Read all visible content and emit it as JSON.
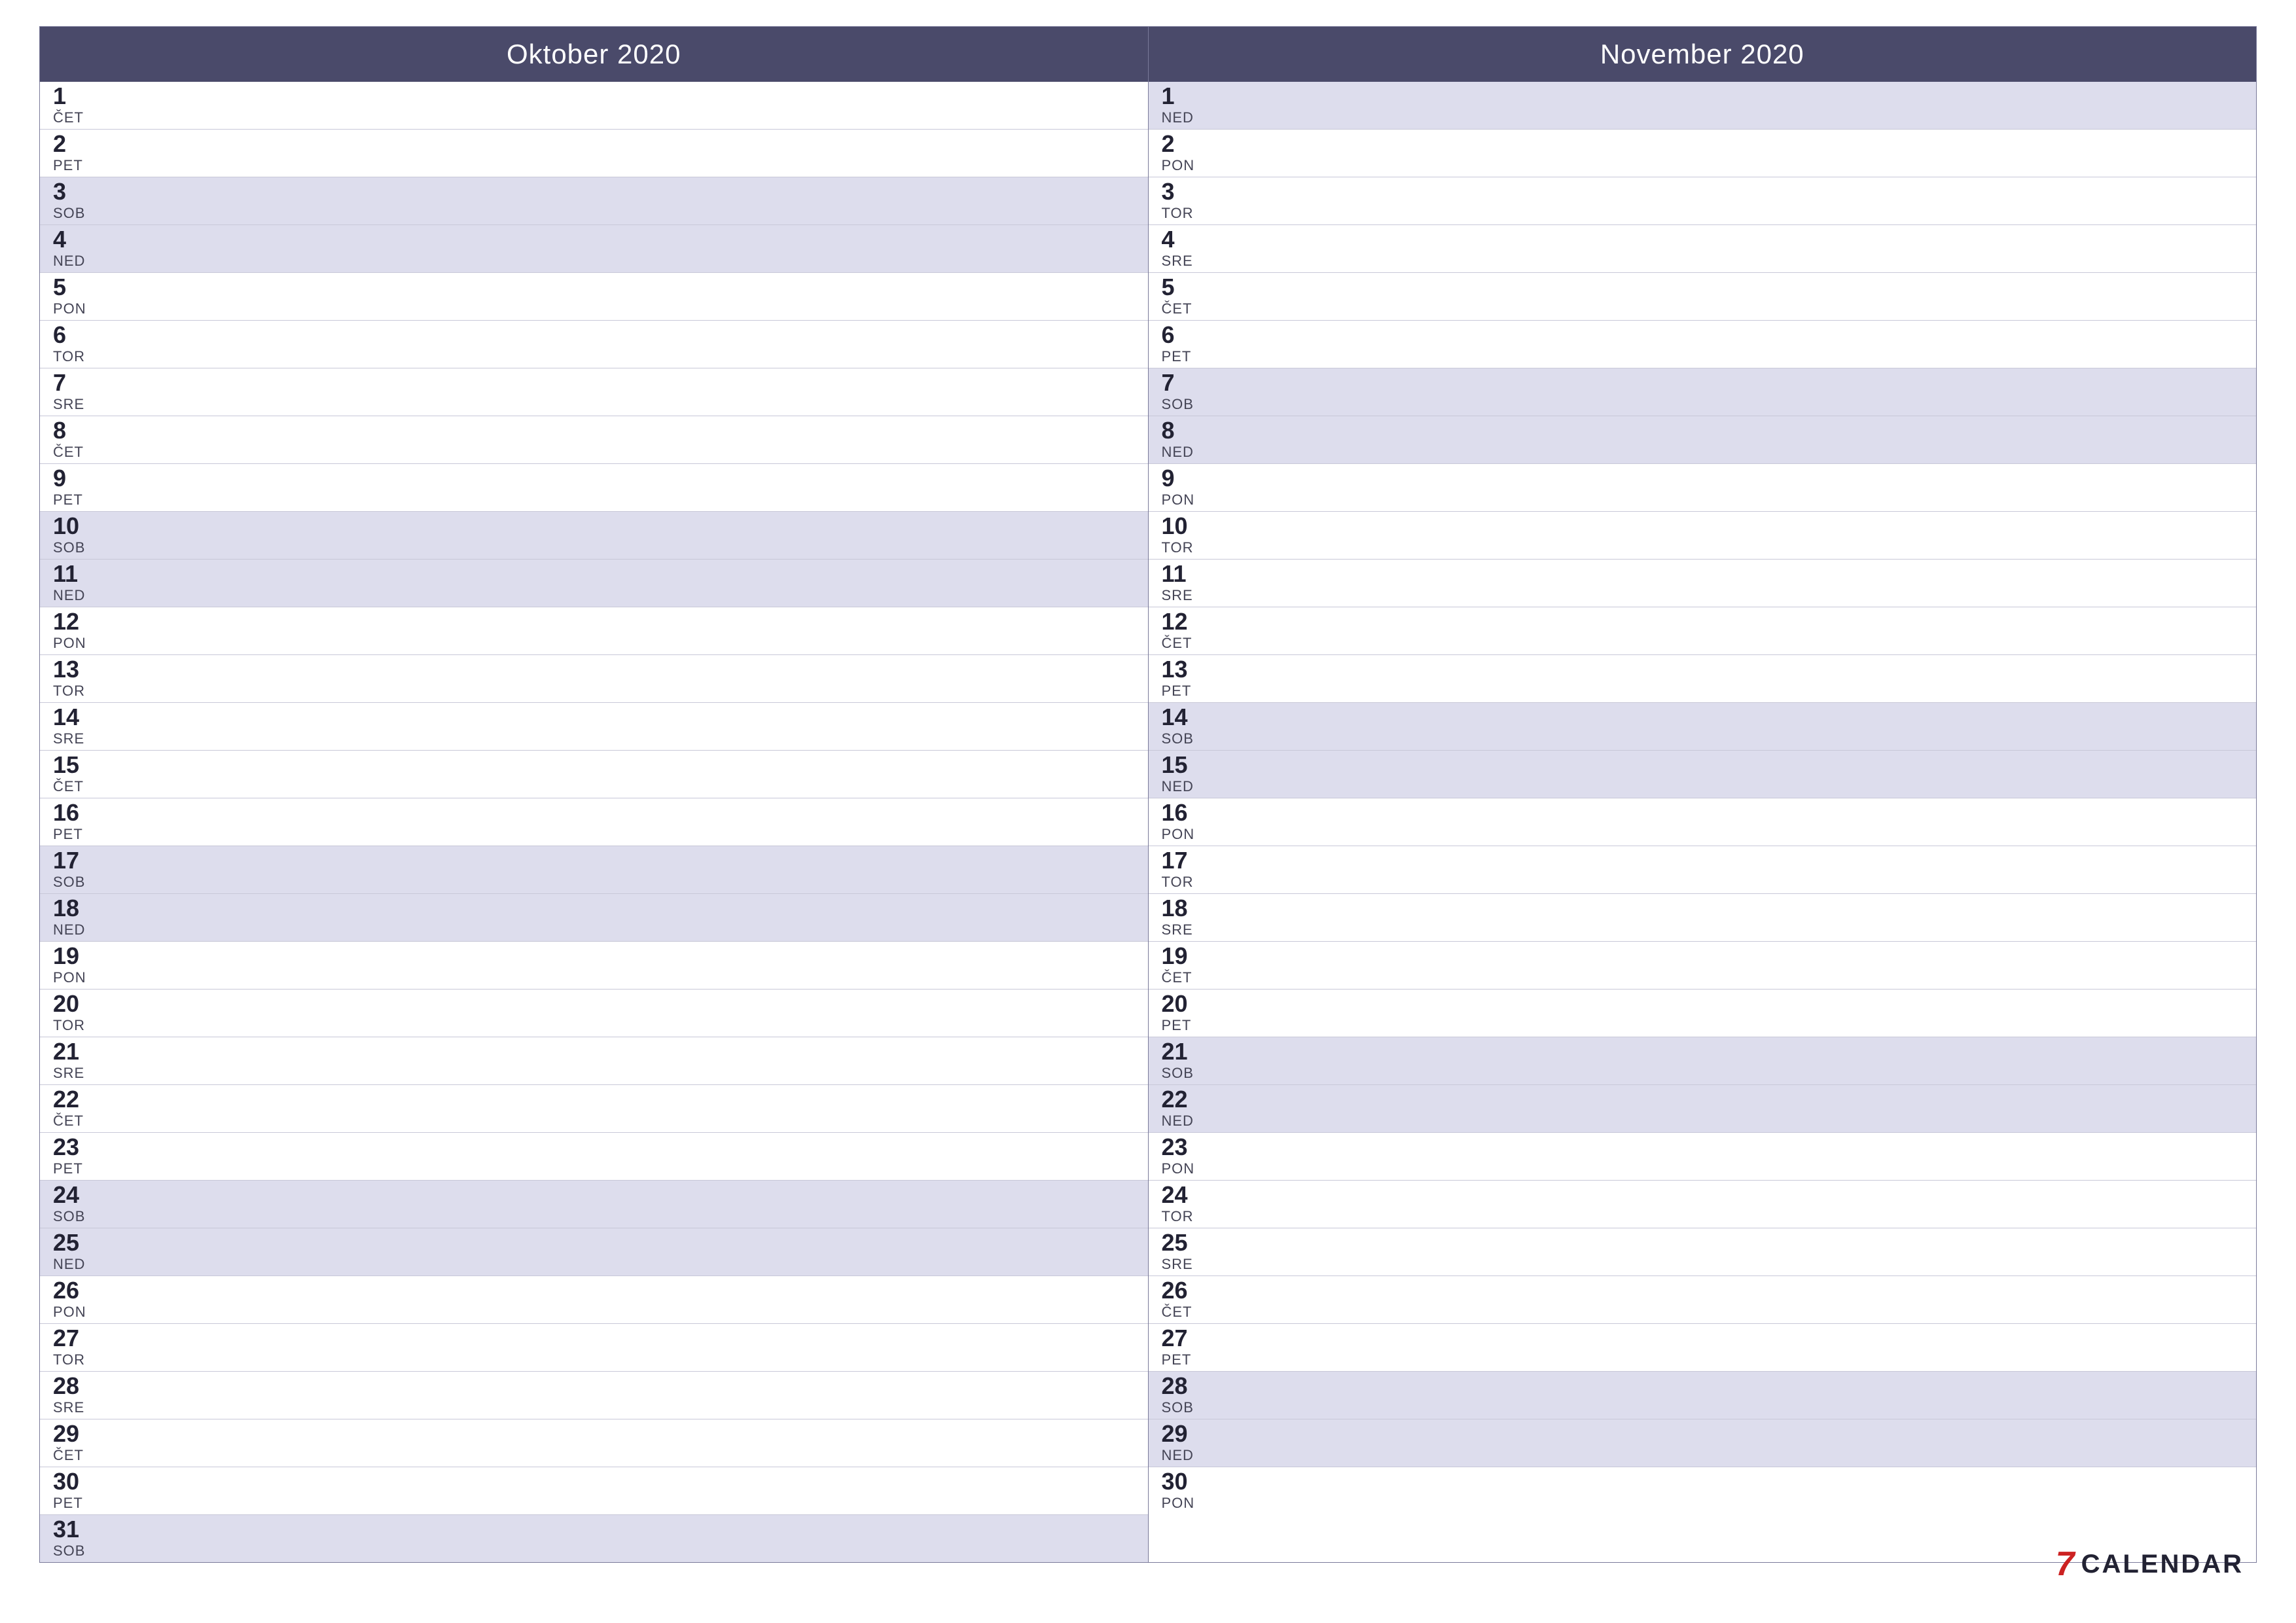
{
  "months": [
    {
      "name": "Oktober 2020",
      "id": "october-2020",
      "days": [
        {
          "num": 1,
          "name": "ČET",
          "weekend": false
        },
        {
          "num": 2,
          "name": "PET",
          "weekend": false
        },
        {
          "num": 3,
          "name": "SOB",
          "weekend": true
        },
        {
          "num": 4,
          "name": "NED",
          "weekend": true
        },
        {
          "num": 5,
          "name": "PON",
          "weekend": false
        },
        {
          "num": 6,
          "name": "TOR",
          "weekend": false
        },
        {
          "num": 7,
          "name": "SRE",
          "weekend": false
        },
        {
          "num": 8,
          "name": "ČET",
          "weekend": false
        },
        {
          "num": 9,
          "name": "PET",
          "weekend": false
        },
        {
          "num": 10,
          "name": "SOB",
          "weekend": true
        },
        {
          "num": 11,
          "name": "NED",
          "weekend": true
        },
        {
          "num": 12,
          "name": "PON",
          "weekend": false
        },
        {
          "num": 13,
          "name": "TOR",
          "weekend": false
        },
        {
          "num": 14,
          "name": "SRE",
          "weekend": false
        },
        {
          "num": 15,
          "name": "ČET",
          "weekend": false
        },
        {
          "num": 16,
          "name": "PET",
          "weekend": false
        },
        {
          "num": 17,
          "name": "SOB",
          "weekend": true
        },
        {
          "num": 18,
          "name": "NED",
          "weekend": true
        },
        {
          "num": 19,
          "name": "PON",
          "weekend": false
        },
        {
          "num": 20,
          "name": "TOR",
          "weekend": false
        },
        {
          "num": 21,
          "name": "SRE",
          "weekend": false
        },
        {
          "num": 22,
          "name": "ČET",
          "weekend": false
        },
        {
          "num": 23,
          "name": "PET",
          "weekend": false
        },
        {
          "num": 24,
          "name": "SOB",
          "weekend": true
        },
        {
          "num": 25,
          "name": "NED",
          "weekend": true
        },
        {
          "num": 26,
          "name": "PON",
          "weekend": false
        },
        {
          "num": 27,
          "name": "TOR",
          "weekend": false
        },
        {
          "num": 28,
          "name": "SRE",
          "weekend": false
        },
        {
          "num": 29,
          "name": "ČET",
          "weekend": false
        },
        {
          "num": 30,
          "name": "PET",
          "weekend": false
        },
        {
          "num": 31,
          "name": "SOB",
          "weekend": true
        }
      ]
    },
    {
      "name": "November 2020",
      "id": "november-2020",
      "days": [
        {
          "num": 1,
          "name": "NED",
          "weekend": true
        },
        {
          "num": 2,
          "name": "PON",
          "weekend": false
        },
        {
          "num": 3,
          "name": "TOR",
          "weekend": false
        },
        {
          "num": 4,
          "name": "SRE",
          "weekend": false
        },
        {
          "num": 5,
          "name": "ČET",
          "weekend": false
        },
        {
          "num": 6,
          "name": "PET",
          "weekend": false
        },
        {
          "num": 7,
          "name": "SOB",
          "weekend": true
        },
        {
          "num": 8,
          "name": "NED",
          "weekend": true
        },
        {
          "num": 9,
          "name": "PON",
          "weekend": false
        },
        {
          "num": 10,
          "name": "TOR",
          "weekend": false
        },
        {
          "num": 11,
          "name": "SRE",
          "weekend": false
        },
        {
          "num": 12,
          "name": "ČET",
          "weekend": false
        },
        {
          "num": 13,
          "name": "PET",
          "weekend": false
        },
        {
          "num": 14,
          "name": "SOB",
          "weekend": true
        },
        {
          "num": 15,
          "name": "NED",
          "weekend": true
        },
        {
          "num": 16,
          "name": "PON",
          "weekend": false
        },
        {
          "num": 17,
          "name": "TOR",
          "weekend": false
        },
        {
          "num": 18,
          "name": "SRE",
          "weekend": false
        },
        {
          "num": 19,
          "name": "ČET",
          "weekend": false
        },
        {
          "num": 20,
          "name": "PET",
          "weekend": false
        },
        {
          "num": 21,
          "name": "SOB",
          "weekend": true
        },
        {
          "num": 22,
          "name": "NED",
          "weekend": true
        },
        {
          "num": 23,
          "name": "PON",
          "weekend": false
        },
        {
          "num": 24,
          "name": "TOR",
          "weekend": false
        },
        {
          "num": 25,
          "name": "SRE",
          "weekend": false
        },
        {
          "num": 26,
          "name": "ČET",
          "weekend": false
        },
        {
          "num": 27,
          "name": "PET",
          "weekend": false
        },
        {
          "num": 28,
          "name": "SOB",
          "weekend": true
        },
        {
          "num": 29,
          "name": "NED",
          "weekend": true
        },
        {
          "num": 30,
          "name": "PON",
          "weekend": false
        }
      ]
    }
  ],
  "brand": {
    "number": "7",
    "text": "CALENDAR"
  }
}
